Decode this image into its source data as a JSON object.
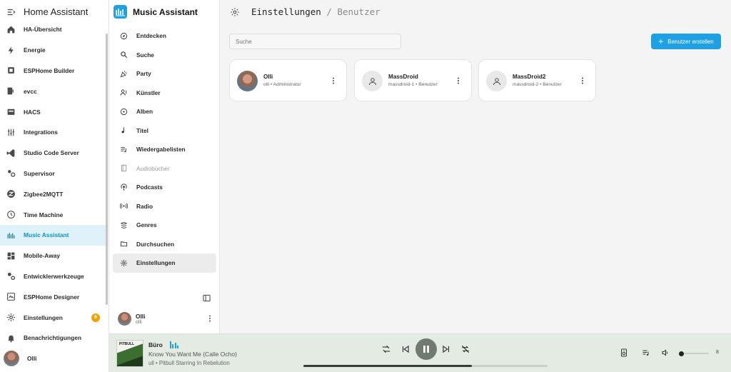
{
  "ha": {
    "title": "Home Assistant",
    "items": [
      {
        "label": "HA-Übersicht",
        "icon": "home-icon"
      },
      {
        "label": "Energie",
        "icon": "lightning-icon"
      },
      {
        "label": "ESPHome Builder",
        "icon": "chip-icon"
      },
      {
        "label": "evcc",
        "icon": "evcc-icon"
      },
      {
        "label": "HACS",
        "icon": "hacs-icon"
      },
      {
        "label": "Integrations",
        "icon": "sliders-icon"
      },
      {
        "label": "Studio Code Server",
        "icon": "vscode-icon"
      },
      {
        "label": "Supervisor",
        "icon": "supervisor-icon"
      },
      {
        "label": "Zigbee2MQTT",
        "icon": "zigbee-icon"
      },
      {
        "label": "Time Machine",
        "icon": "history-icon"
      },
      {
        "label": "Music Assistant",
        "icon": "music-assistant-icon",
        "active": true
      },
      {
        "label": "Mobile-Away",
        "icon": "dashboard-icon"
      },
      {
        "label": "Entwicklerwerkzeuge",
        "icon": "wrench-icon"
      },
      {
        "label": "ESPHome Designer",
        "icon": "designer-icon"
      },
      {
        "label": "Einstellungen",
        "icon": "cog-icon",
        "badge": "6"
      },
      {
        "label": "Benachrichtigungen",
        "icon": "bell-icon"
      },
      {
        "label": "Olli",
        "icon": "user-avatar"
      }
    ]
  },
  "ma": {
    "title": "Music Assistant",
    "items": [
      {
        "label": "Entdecken",
        "icon": "compass-icon"
      },
      {
        "label": "Suche",
        "icon": "search-icon"
      },
      {
        "label": "Party",
        "icon": "party-icon"
      },
      {
        "label": "Künstler",
        "icon": "artist-icon"
      },
      {
        "label": "Alben",
        "icon": "album-icon"
      },
      {
        "label": "Titel",
        "icon": "music-note-icon"
      },
      {
        "label": "Wiedergabelisten",
        "icon": "playlist-icon"
      },
      {
        "label": "Audiobücher",
        "icon": "book-icon",
        "disabled": true
      },
      {
        "label": "Podcasts",
        "icon": "podcast-icon"
      },
      {
        "label": "Radio",
        "icon": "radio-icon"
      },
      {
        "label": "Genres",
        "icon": "genres-icon"
      },
      {
        "label": "Durchsuchen",
        "icon": "folder-icon"
      },
      {
        "label": "Einstellungen",
        "icon": "cog-icon",
        "active": true
      }
    ],
    "user": {
      "name": "Olli",
      "sub": "olli"
    }
  },
  "main": {
    "breadcrumb": {
      "current": "Einstellungen",
      "separator": "/",
      "last": "Benutzer"
    },
    "search_placeholder": "Suche",
    "create_button": "Benutzer erstellen",
    "users": [
      {
        "name": "Olli",
        "sub": "olli • Administrator",
        "photo": true
      },
      {
        "name": "MassDroid",
        "sub": "massdroid-1 • Benutzer",
        "photo": false
      },
      {
        "name": "MassDroid2",
        "sub": "massdroid-2 • Benutzer",
        "photo": false
      }
    ]
  },
  "player": {
    "player_name": "Büro",
    "track_title": "Know You Want Me (Calle Ocho)",
    "artist_album": "ull • Pitbull Starring In Rebelution",
    "cover_text": "PITBULL",
    "progress": 0.69,
    "volume": 0.0,
    "volume_label": "8"
  },
  "colors": {
    "accent": "#1ea1e4",
    "badge": "#f2a100",
    "player_bg": "#e3ebe3"
  }
}
